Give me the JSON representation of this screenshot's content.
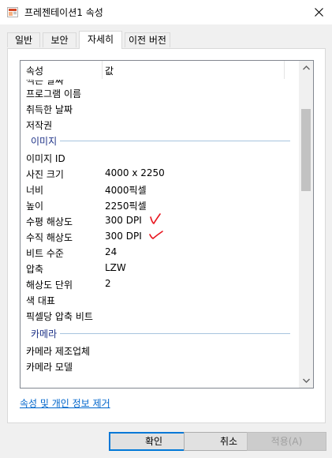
{
  "window": {
    "title": "프레젠테이션1 속성",
    "icon": "powerpoint-document-icon",
    "close_icon": "close-icon"
  },
  "tabs": [
    {
      "label": "일반",
      "active": false
    },
    {
      "label": "보안",
      "active": false
    },
    {
      "label": "자세히",
      "active": true
    },
    {
      "label": "이전 버전",
      "active": false
    }
  ],
  "details": {
    "columns": {
      "property": "속성",
      "value": "값"
    },
    "partial_row": "찍은 날짜",
    "rows_top": [
      {
        "name": "프로그램 이름",
        "value": ""
      },
      {
        "name": "취득한 날짜",
        "value": ""
      },
      {
        "name": "저작권",
        "value": ""
      }
    ],
    "group_image": "이미지",
    "rows_image": [
      {
        "name": "이미지 ID",
        "value": ""
      },
      {
        "name": "사진 크기",
        "value": "4000 x 2250"
      },
      {
        "name": "너비",
        "value": "4000픽셀"
      },
      {
        "name": "높이",
        "value": "2250픽셀"
      },
      {
        "name": "수평 해상도",
        "value": "300 DPI"
      },
      {
        "name": "수직 해상도",
        "value": "300 DPI"
      },
      {
        "name": "비트 수준",
        "value": "24"
      },
      {
        "name": "압축",
        "value": "LZW"
      },
      {
        "name": "해상도 단위",
        "value": "2"
      },
      {
        "name": "색 대표",
        "value": ""
      },
      {
        "name": "픽셀당 압축 비트",
        "value": ""
      }
    ],
    "group_camera": "카메라",
    "rows_camera": [
      {
        "name": "카메라 제조업체",
        "value": ""
      },
      {
        "name": "카메라 모델",
        "value": ""
      }
    ],
    "scroll_position": 0.23
  },
  "annotation_color": "#e8141d",
  "link_text": "속성 및 개인 정보 제거",
  "buttons": {
    "ok": "확인",
    "cancel": "취소",
    "apply": "적용(A)"
  },
  "colors": {
    "accent": "#0078d7",
    "link": "#0066cc",
    "group_title": "#1e3287"
  }
}
